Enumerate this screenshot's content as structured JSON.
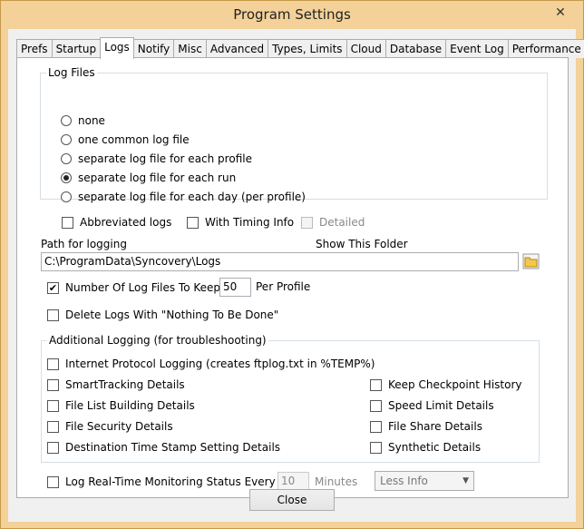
{
  "window": {
    "title": "Program Settings"
  },
  "tabs": [
    "Prefs",
    "Startup",
    "Logs",
    "Notify",
    "Misc",
    "Advanced",
    "Types, Limits",
    "Cloud",
    "Database",
    "Event Log",
    "Performance"
  ],
  "active_tab": "Logs",
  "log_files": {
    "title": "Log Files",
    "options": [
      "none",
      "one common log file",
      "separate log file for each profile",
      "separate log file for each run",
      "separate log file for each day (per profile)"
    ],
    "selected": "separate log file for each run",
    "abbreviated": {
      "label": "Abbreviated logs",
      "checked": false
    },
    "timing": {
      "label": "With Timing Info",
      "checked": false
    },
    "detailed": {
      "label": "Detailed",
      "checked": false,
      "enabled": false
    }
  },
  "path": {
    "label": "Path for logging",
    "show_folder": "Show This Folder",
    "value": "C:\\ProgramData\\Syncovery\\Logs"
  },
  "keep": {
    "label": "Number Of Log Files To Keep:",
    "value": "50",
    "suffix": "Per Profile",
    "checked": true
  },
  "delete_nothing": {
    "label": "Delete Logs With \"Nothing To Be Done\"",
    "checked": false
  },
  "additional": {
    "title": "Additional Logging (for troubleshooting)",
    "internet": "Internet Protocol Logging (creates ftplog.txt in %TEMP%)",
    "left": [
      "SmartTracking Details",
      "File List Building Details",
      "File Security Details",
      "Destination Time Stamp Setting Details"
    ],
    "right": [
      "Keep Checkpoint History",
      "Speed Limit Details",
      "File Share Details",
      "Synthetic Details"
    ]
  },
  "realtime": {
    "label": "Log Real-Time Monitoring Status Every",
    "value": "10",
    "unit": "Minutes",
    "dropdown": "Less Info"
  },
  "close_button": "Close"
}
